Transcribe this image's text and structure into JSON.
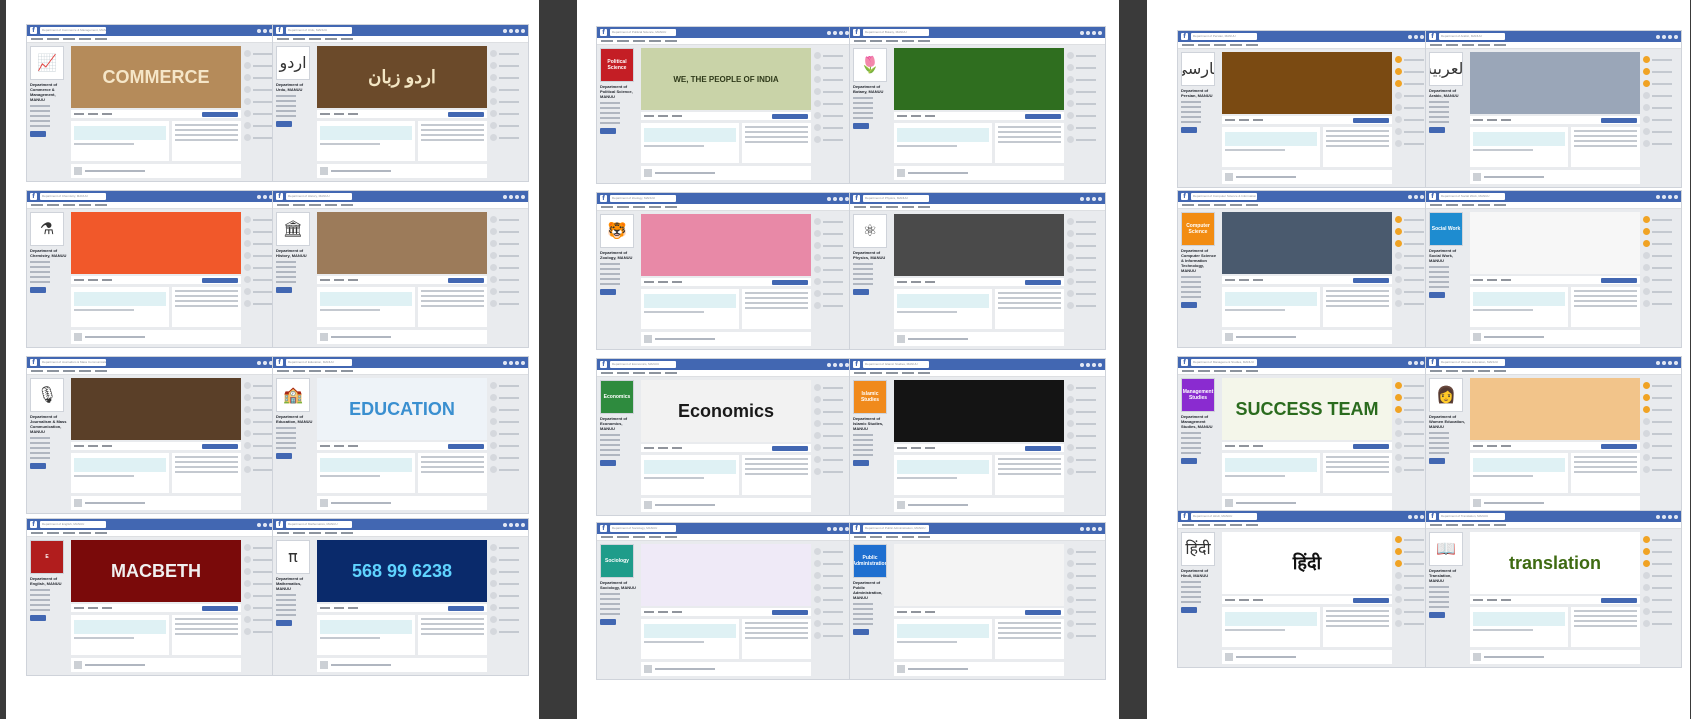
{
  "panels": [
    {
      "cards": [
        {
          "dept": "Department of Commerce & Management, MANUU",
          "profile_label": "",
          "profile_symbol": "📈",
          "profile_bg": "#ffffff",
          "cover_text": "COMMERCE",
          "cover_bg": "#b58b5a",
          "cover_fg": "#f5e6c8"
        },
        {
          "dept": "Department of Urdu, MANUU",
          "profile_label": "",
          "profile_symbol": "اردو",
          "profile_bg": "#ffffff",
          "cover_text": "اردو زبان",
          "cover_bg": "#6b4a2a",
          "cover_fg": "#f3e6c4"
        },
        {
          "dept": "Department of Chemistry, MANUU",
          "profile_label": "",
          "profile_symbol": "⚗",
          "profile_bg": "#ffffff",
          "cover_text": "",
          "cover_bg": "#f1582a",
          "cover_fg": "#ffd54a"
        },
        {
          "dept": "Department of History, MANUU",
          "profile_label": "",
          "profile_symbol": "🏛",
          "profile_bg": "#ffffff",
          "cover_text": "",
          "cover_bg": "#9c7b5a",
          "cover_fg": "#ffffff"
        },
        {
          "dept": "Department of Journalism & Mass Communication, MANUU",
          "profile_label": "",
          "profile_symbol": "🎙",
          "profile_bg": "#ffffff",
          "cover_text": "",
          "cover_bg": "#5a3f28",
          "cover_fg": "#d9a86b"
        },
        {
          "dept": "Department of Education, MANUU",
          "profile_label": "",
          "profile_symbol": "🏫",
          "profile_bg": "#ffffff",
          "cover_text": "EDUCATION",
          "cover_bg": "#eef3f8",
          "cover_fg": "#3a8fd0"
        },
        {
          "dept": "Department of English, MANUU",
          "profile_label": "E",
          "profile_symbol": "",
          "profile_bg": "#b11d1d",
          "cover_text": "MACBETH",
          "cover_bg": "#7a0a0a",
          "cover_fg": "#f0f0f0"
        },
        {
          "dept": "Department of Mathematics, MANUU",
          "profile_label": "",
          "profile_symbol": "π",
          "profile_bg": "#ffffff",
          "cover_text": "568 99 6238",
          "cover_bg": "#0a2a6b",
          "cover_fg": "#5fd3ff"
        }
      ]
    },
    {
      "cards": [
        {
          "dept": "Department of Political Science, MANUU",
          "profile_label": "Political Science",
          "profile_symbol": "",
          "profile_bg": "#c41e25",
          "cover_text": "WE, THE PEOPLE OF INDIA",
          "cover_bg": "#c9d3a8",
          "cover_fg": "#2f3a1a"
        },
        {
          "dept": "Department of Botany, MANUU",
          "profile_label": "",
          "profile_symbol": "🌷",
          "profile_bg": "#ffffff",
          "cover_text": "",
          "cover_bg": "#2f6e1f",
          "cover_fg": "#e01c7b"
        },
        {
          "dept": "Department of Zoology, MANUU",
          "profile_label": "",
          "profile_symbol": "🐯",
          "profile_bg": "#ffffff",
          "cover_text": "",
          "cover_bg": "#e889a7",
          "cover_fg": "#ffffff"
        },
        {
          "dept": "Department of Physics, MANUU",
          "profile_label": "",
          "profile_symbol": "⚛",
          "profile_bg": "#ffffff",
          "cover_text": "",
          "cover_bg": "#4a4a4a",
          "cover_fg": "#dddddd"
        },
        {
          "dept": "Department of Economics, MANUU",
          "profile_label": "Economics",
          "profile_symbol": "",
          "profile_bg": "#2e8b3e",
          "cover_text": "Economics",
          "cover_bg": "#f2f2f2",
          "cover_fg": "#1a1a1a"
        },
        {
          "dept": "Department of Islamic Studies, MANUU",
          "profile_label": "Islamic Studies",
          "profile_symbol": "",
          "profile_bg": "#f08a1c",
          "cover_text": "",
          "cover_bg": "#141414",
          "cover_fg": "#e6c27a"
        },
        {
          "dept": "Department of Sociology, MANUU",
          "profile_label": "Sociology",
          "profile_symbol": "",
          "profile_bg": "#1e9c8a",
          "cover_text": "",
          "cover_bg": "#efeaf7",
          "cover_fg": "#5b3fd0"
        },
        {
          "dept": "Department of Public Administration, MANUU",
          "profile_label": "Public Administration",
          "profile_symbol": "",
          "profile_bg": "#1e6fd0",
          "cover_text": "",
          "cover_bg": "#f4f4f4",
          "cover_fg": "#222222"
        }
      ]
    },
    {
      "cards": [
        {
          "dept": "Department of Persian, MANUU",
          "profile_label": "",
          "profile_symbol": "فارسی",
          "profile_bg": "#ffffff",
          "cover_text": "",
          "cover_bg": "#7a4a12",
          "cover_fg": "#ffcf6b"
        },
        {
          "dept": "Department of Arabic, MANUU",
          "profile_label": "",
          "profile_symbol": "العربية",
          "profile_bg": "#ffffff",
          "cover_text": "",
          "cover_bg": "#9aa6b8",
          "cover_fg": "#ffffff"
        },
        {
          "dept": "Department of Computer Science & Information Technology, MANUU",
          "profile_label": "Computer Science",
          "profile_symbol": "",
          "profile_bg": "#f28c12",
          "cover_text": "",
          "cover_bg": "#4a5a6e",
          "cover_fg": "#c8d8ea"
        },
        {
          "dept": "Department of Social Work, MANUU",
          "profile_label": "Social Work",
          "profile_symbol": "",
          "profile_bg": "#1e8cd0",
          "cover_text": "",
          "cover_bg": "#f7f7f7",
          "cover_fg": "#e8432a"
        },
        {
          "dept": "Department of Management Studies, MANUU",
          "profile_label": "Management Studies",
          "profile_symbol": "",
          "profile_bg": "#8a2bd0",
          "cover_text": "SUCCESS  TEAM",
          "cover_bg": "#f4f6ea",
          "cover_fg": "#2a6b1e"
        },
        {
          "dept": "Department of Women Education, MANUU",
          "profile_label": "",
          "profile_symbol": "👩",
          "profile_bg": "#ffffff",
          "cover_text": "",
          "cover_bg": "#f2c48a",
          "cover_fg": "#1e3f8a"
        },
        {
          "dept": "Department of Hindi, MANUU",
          "profile_label": "",
          "profile_symbol": "हिंदी",
          "profile_bg": "#ffffff",
          "cover_text": "हिंदी",
          "cover_bg": "#ffffff",
          "cover_fg": "#111111"
        },
        {
          "dept": "Department of Translation, MANUU",
          "profile_label": "",
          "profile_symbol": "📖",
          "profile_bg": "#ffffff",
          "cover_text": "translation",
          "cover_bg": "#ffffff",
          "cover_fg": "#3f6b12"
        }
      ]
    }
  ]
}
